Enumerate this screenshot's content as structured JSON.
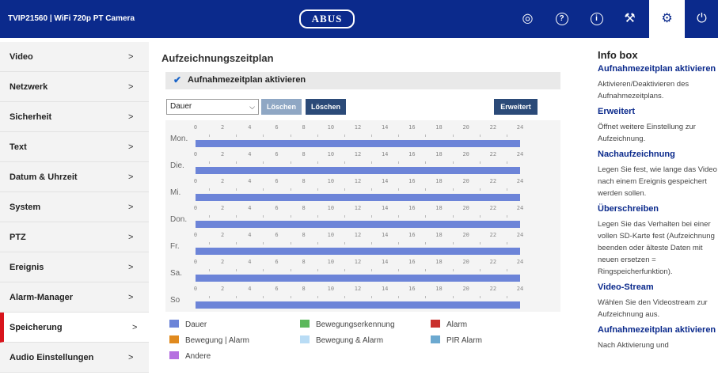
{
  "header": {
    "title": "TVIP21560  |  WiFi 720p PT Camera",
    "logo_text": "ABUS",
    "icons": [
      "target-icon",
      "help-icon",
      "info-icon",
      "tools-icon",
      "settings-icon",
      "power-icon"
    ]
  },
  "sidebar": {
    "items": [
      {
        "label": "Video",
        "chevron": ">"
      },
      {
        "label": "Netzwerk",
        "chevron": ">"
      },
      {
        "label": "Sicherheit",
        "chevron": ">"
      },
      {
        "label": "Text",
        "chevron": ">"
      },
      {
        "label": "Datum & Uhrzeit",
        "chevron": ">"
      },
      {
        "label": "System",
        "chevron": ">"
      },
      {
        "label": "PTZ",
        "chevron": ">"
      },
      {
        "label": "Ereignis",
        "chevron": ">"
      },
      {
        "label": "Alarm-Manager",
        "chevron": ">"
      },
      {
        "label": "Speicherung",
        "chevron": ">",
        "active": true
      },
      {
        "label": "Audio Einstellungen",
        "chevron": ">"
      }
    ]
  },
  "main": {
    "title": "Aufzeichnungszeitplan",
    "enable_label": "Aufnahmezeitplan aktivieren",
    "enable_checked": true,
    "type_select": "Dauer",
    "btn_delete1": "Löschen",
    "btn_delete2": "Löschen",
    "btn_advanced": "Erweitert",
    "hours": [
      "0",
      "2",
      "4",
      "6",
      "8",
      "10",
      "12",
      "14",
      "16",
      "18",
      "20",
      "22",
      "24"
    ],
    "days": [
      {
        "name": "Mon.",
        "recording": "Dauer",
        "from": 0,
        "to": 24
      },
      {
        "name": "Die.",
        "recording": "Dauer",
        "from": 0,
        "to": 24
      },
      {
        "name": "Mi.",
        "recording": "Dauer",
        "from": 0,
        "to": 24
      },
      {
        "name": "Don.",
        "recording": "Dauer",
        "from": 0,
        "to": 24
      },
      {
        "name": "Fr.",
        "recording": "Dauer",
        "from": 0,
        "to": 24
      },
      {
        "name": "Sa.",
        "recording": "Dauer",
        "from": 0,
        "to": 24
      },
      {
        "name": "So",
        "recording": "Dauer",
        "from": 0,
        "to": 24
      }
    ],
    "legend": [
      {
        "label": "Dauer",
        "color": "#6c84d8"
      },
      {
        "label": "Bewegungserkennung",
        "color": "#5cb85c"
      },
      {
        "label": "Alarm",
        "color": "#c9302c"
      },
      {
        "label": "Bewegung | Alarm",
        "color": "#e08a1e"
      },
      {
        "label": "Bewegung & Alarm",
        "color": "#b9dcf5"
      },
      {
        "label": "PIR Alarm",
        "color": "#6ca9d0"
      },
      {
        "label": "Andere",
        "color": "#b56fe0"
      }
    ]
  },
  "info": {
    "title": "Info box",
    "sections": [
      {
        "heading": "Aufnahmezeitplan aktivieren",
        "text": "Aktivieren/Deaktivieren des Aufnahmezeitplans."
      },
      {
        "heading": "Erweitert",
        "text": "Öffnet weitere Einstellung zur Aufzeichnung."
      },
      {
        "heading": "Nachaufzeichnung",
        "text": "Legen Sie fest, wie lange das Video nach einem Ereignis gespeichert werden sollen."
      },
      {
        "heading": "Überschreiben",
        "text": "Legen Sie das Verhalten bei einer vollen SD-Karte fest (Aufzeichnung beenden oder älteste Daten mit neuen ersetzen = Ringspeicherfunktion)."
      },
      {
        "heading": "Video-Stream",
        "text": "Wählen Sie den Videostream zur Aufzeichnung aus."
      },
      {
        "heading": "Aufnahmezeitplan aktivieren",
        "text": "Nach Aktivierung und"
      }
    ]
  },
  "colors": {
    "header_bg": "#0b2a8c",
    "accent_red": "#d8141c",
    "schedule_bar": "#6c84d8"
  }
}
